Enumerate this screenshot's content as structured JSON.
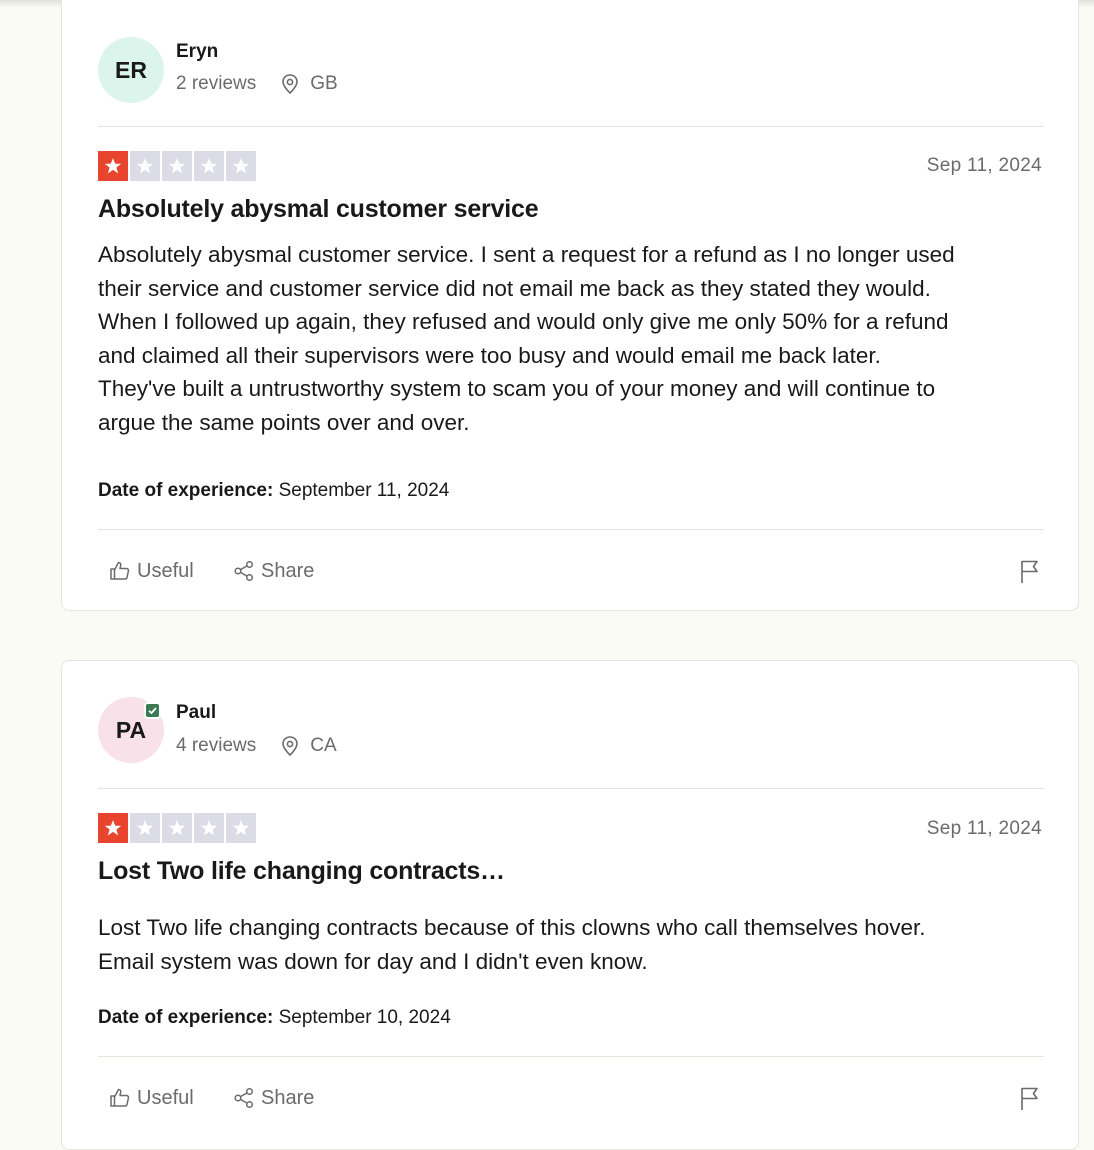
{
  "reviews": [
    {
      "avatar_initials": "ER",
      "avatar_color": "#dcf5ec",
      "verified": false,
      "name": "Eryn",
      "review_count": "2 reviews",
      "country": "GB",
      "rating": 1,
      "date": "Sep 11, 2024",
      "title": "Absolutely abysmal customer service",
      "body": [
        "Absolutely abysmal customer service. I sent a request for a refund as I no longer used",
        "their service and customer service did not email me back as they stated they would.",
        "When I followed up again, they refused and would only give me only 50% for a refund",
        "and claimed all their supervisors were too busy and would email me back later.",
        "They've built a untrustworthy system to scam you of your money and will continue to",
        "argue the same points over and over."
      ],
      "experience_label": "Date of experience:",
      "experience_date": "September 11, 2024",
      "useful_label": "Useful",
      "share_label": "Share"
    },
    {
      "avatar_initials": "PA",
      "avatar_color": "#f8e1e9",
      "verified": true,
      "name": "Paul",
      "review_count": "4 reviews",
      "country": "CA",
      "rating": 1,
      "date": "Sep 11, 2024",
      "title": "Lost Two life changing contracts…",
      "body": [
        "Lost Two life changing contracts because of this clowns who call themselves hover.",
        "Email system was down for day and I didn't even know."
      ],
      "experience_label": "Date of experience:",
      "experience_date": "September 10, 2024",
      "useful_label": "Useful",
      "share_label": "Share"
    }
  ],
  "colors": {
    "star_filled": "#e8442e",
    "star_empty": "#dcdce6",
    "verified": "#3d7a54"
  },
  "icons": {
    "location": "location-pin-icon",
    "useful": "thumbs-up-icon",
    "share": "share-icon",
    "report": "flag-icon",
    "rating": "star-icon",
    "verified": "check-icon"
  }
}
